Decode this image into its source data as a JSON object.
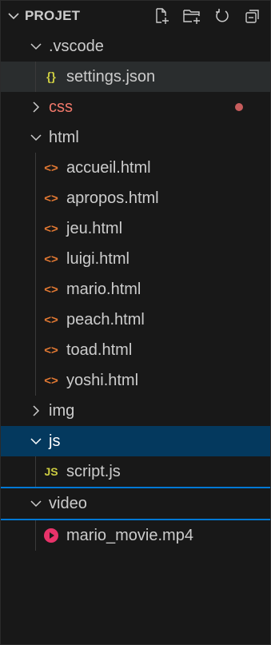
{
  "explorer": {
    "title": "PROJET",
    "actions": [
      {
        "name": "new-file-icon"
      },
      {
        "name": "new-folder-icon"
      },
      {
        "name": "refresh-icon"
      },
      {
        "name": "collapse-all-icon"
      }
    ]
  },
  "tree": {
    "vscode": {
      "label": ".vscode",
      "children": [
        {
          "label": "settings.json",
          "icon": "json-braces-icon",
          "icon_text": "{}",
          "icon_color": "#cbcb41"
        }
      ]
    },
    "css": {
      "label": "css",
      "color": "#f0786a",
      "dot_color": "#c65c5c"
    },
    "html": {
      "label": "html",
      "children": [
        {
          "label": "accueil.html"
        },
        {
          "label": "apropos.html"
        },
        {
          "label": "jeu.html"
        },
        {
          "label": "luigi.html"
        },
        {
          "label": "mario.html"
        },
        {
          "label": "peach.html"
        },
        {
          "label": "toad.html"
        },
        {
          "label": "yoshi.html"
        }
      ],
      "icon_text": "<>",
      "icon_color": "#e37933"
    },
    "img": {
      "label": "img"
    },
    "js": {
      "label": "js",
      "children": [
        {
          "label": "script.js",
          "icon_text": "JS",
          "icon_color": "#cbcb41"
        }
      ]
    },
    "video": {
      "label": "video",
      "children": [
        {
          "label": "mario_movie.mp4",
          "icon_color": "#e8336a"
        }
      ]
    }
  },
  "colors": {
    "background": "#181818",
    "selected_soft": "#2a2d2e",
    "selected_strong": "#04395e",
    "focus": "#0078d4",
    "text": "#cccccc"
  }
}
